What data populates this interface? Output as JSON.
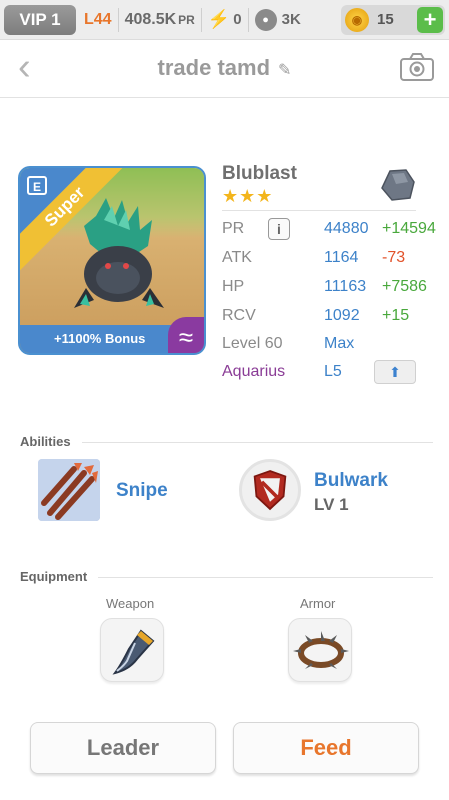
{
  "topbar": {
    "vip": "VIP 1",
    "level": "L44",
    "power": "408.5K",
    "power_unit": "PR",
    "energy": "0",
    "paws": "3K",
    "gems": "15",
    "add": "+"
  },
  "header": {
    "back": "‹",
    "title": "trade tamd"
  },
  "monster": {
    "name": "Blublast",
    "stars": "★★★",
    "rarity": "Super",
    "bonus": "+1100% Bonus",
    "element_symbol": "≈",
    "stats": [
      {
        "label": "PR",
        "value": "44880",
        "delta": "+14594"
      },
      {
        "label": "ATK",
        "value": "1164",
        "delta": "-73"
      },
      {
        "label": "HP",
        "value": "11163",
        "delta": "+7586"
      },
      {
        "label": "RCV",
        "value": "1092",
        "delta": "+15"
      }
    ],
    "level_label": "Level 60",
    "level_value": "Max",
    "sign_label": "Aquarius",
    "sign_value": "L5"
  },
  "abilities": {
    "label": "Abilities",
    "items": [
      {
        "name": "Snipe"
      },
      {
        "name": "Bulwark",
        "level": "LV 1"
      }
    ]
  },
  "equipment": {
    "label": "Equipment",
    "weapon_label": "Weapon",
    "armor_label": "Armor"
  },
  "buttons": {
    "leader": "Leader",
    "feed": "Feed"
  }
}
